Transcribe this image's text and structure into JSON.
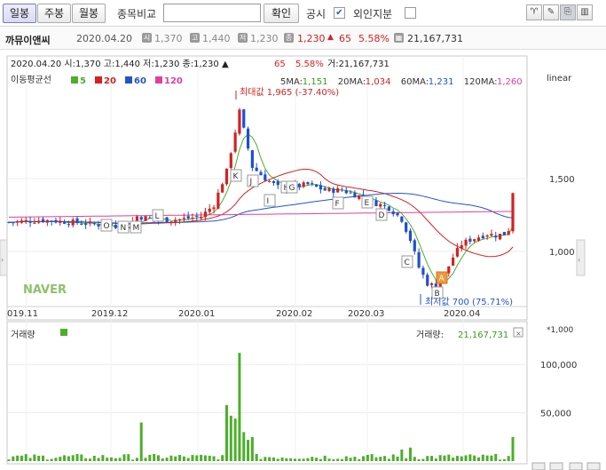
{
  "toolbar": {
    "daily": "일봉",
    "weekly": "주봉",
    "monthly": "월봉",
    "compare_label": "종목비교",
    "compare_value": "",
    "confirm": "확인",
    "disclosure": "공시",
    "disclosure_checked": "✔",
    "foreign": "외인지분",
    "foreign_checked": "",
    "icons": [
      "pin-icon",
      "pencil-icon",
      "eraser-icon",
      "bar-chart-icon"
    ]
  },
  "info": {
    "name": "까뮤이앤씨",
    "date": "2020.04.20",
    "open_label": "시",
    "open": "1,370",
    "high_label": "고",
    "high": "1,440",
    "low_label": "저",
    "low": "1,230",
    "close_label": "종",
    "close": "1,230",
    "change_arrow": "▲",
    "change": "65",
    "change_pct": "5.58%",
    "volume_icon": "chart-icon",
    "volume": "21,167,731"
  },
  "chart_data": {
    "type": "candlestick",
    "header": "2020.04.20 시:1,370 고:1,440 저:1,230 종:1,230 ▲",
    "header_change": "65",
    "header_pct": "5.58%",
    "header_volume": "거:21,167,731",
    "ma_label": "이동평균선",
    "ma_legend": [
      {
        "name": "5",
        "color": "#4caf2a"
      },
      {
        "name": "20",
        "color": "#d32222"
      },
      {
        "name": "60",
        "color": "#2255c8"
      },
      {
        "name": "120",
        "color": "#e0409a"
      }
    ],
    "ma_values": [
      {
        "label": "5MA:",
        "value": "1,151",
        "color": "#3a9c1e"
      },
      {
        "label": "20MA:",
        "value": "1,034",
        "color": "#d32222"
      },
      {
        "label": "60MA:",
        "value": "1,231",
        "color": "#2255c8"
      },
      {
        "label": "120MA:",
        "value": "1,260",
        "color": "#e0409a"
      }
    ],
    "scale": "linear",
    "y_ticks": [
      {
        "value": 1500,
        "label": "1,500"
      },
      {
        "value": 1000,
        "label": "1,000"
      }
    ],
    "ylim": [
      640,
      2140
    ],
    "x_labels": [
      "019.11",
      "2019.12",
      "2020.01",
      "2020.02",
      "2020.03",
      "2020.04"
    ],
    "max_annotation": "최대값 1,965 (-37.40%)",
    "min_annotation": "최저값 700 (75.71%)",
    "watermark": "NAVER",
    "markers": [
      "O",
      "N",
      "M",
      "L",
      "K",
      "J",
      "I",
      "H",
      "G",
      "F",
      "E",
      "D",
      "C",
      "B",
      "A"
    ],
    "volume": {
      "title": "거래량",
      "label": "거래량:",
      "value": "21,167,731",
      "unit": "*1,000",
      "ticks": [
        {
          "value": 100000,
          "label": "100,000"
        },
        {
          "value": 50000,
          "label": "50,000"
        }
      ],
      "ylim": [
        0,
        125000
      ]
    }
  }
}
